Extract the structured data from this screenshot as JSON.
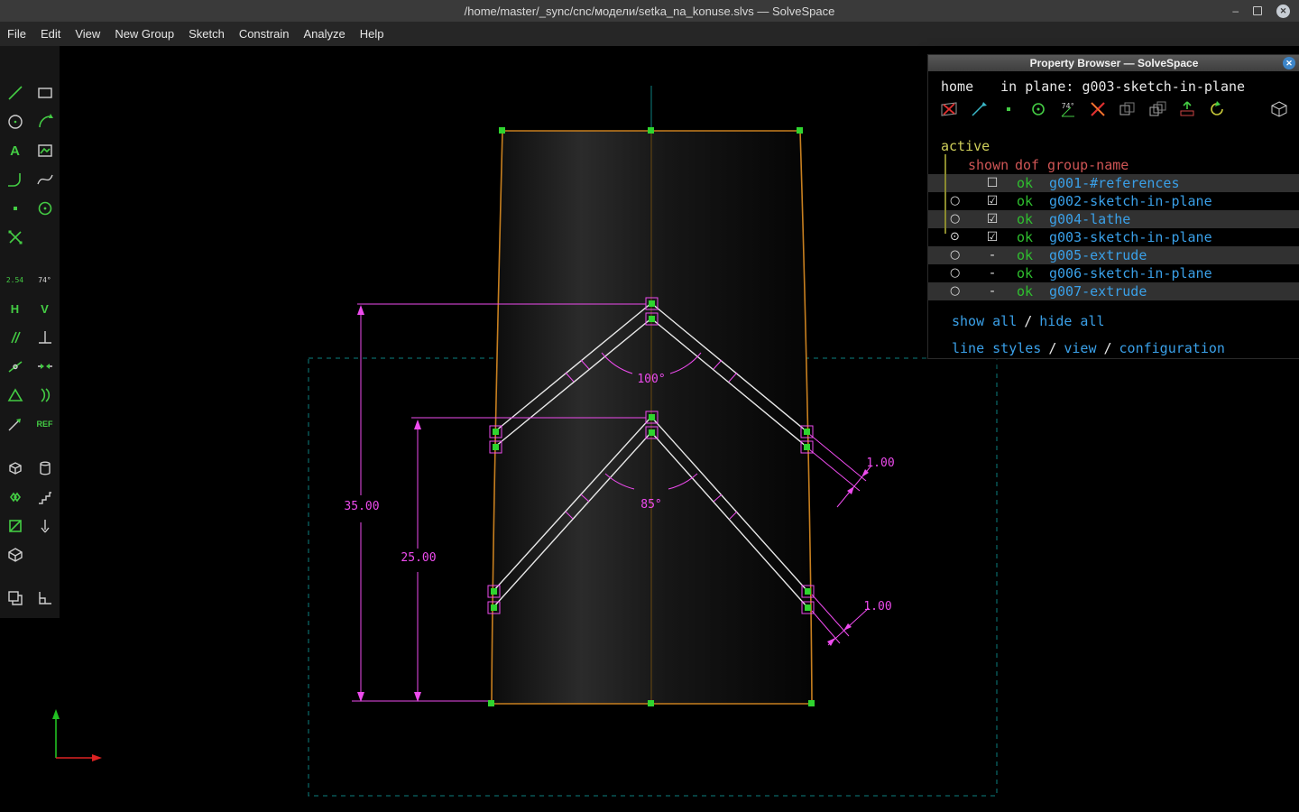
{
  "window": {
    "title": "/home/master/_sync/cnc/модели/setka_na_konuse.slvs — SolveSpace",
    "minimize": "–",
    "restore": "❐",
    "close": "✕"
  },
  "menu": {
    "file": "File",
    "edit": "Edit",
    "view": "View",
    "new_group": "New Group",
    "sketch": "Sketch",
    "constrain": "Constrain",
    "analyze": "Analyze",
    "help": "Help"
  },
  "tools": {
    "text": "A",
    "distance": "2.54",
    "angle": "74°",
    "horizontal": "H",
    "vertical": "V",
    "reference": "REF"
  },
  "canvas": {
    "dim_total": "35.00",
    "dim_lower": "25.00",
    "angle_upper": "100°",
    "angle_lower": "85°",
    "width_upper": "1.00",
    "width_lower": "1.00"
  },
  "pb": {
    "title": "Property Browser — SolveSpace",
    "close": "✕",
    "home": "home",
    "in_plane_label": "in plane:",
    "in_plane_value": "g003-sketch-in-plane",
    "angle_tool_label": "74°",
    "active": "active",
    "header": {
      "shown": "shown",
      "dof": "dof",
      "group_name": "group-name"
    },
    "groups": [
      {
        "radio": "",
        "shown": "☐",
        "dof": "ok",
        "name": "g001-#references"
      },
      {
        "radio": "○",
        "shown": "☑",
        "dof": "ok",
        "name": "g002-sketch-in-plane"
      },
      {
        "radio": "○",
        "shown": "☑",
        "dof": "ok",
        "name": "g004-lathe"
      },
      {
        "radio": "⊙",
        "shown": "☑",
        "dof": "ok",
        "name": "g003-sketch-in-plane"
      },
      {
        "radio": "○",
        "shown": "-",
        "dof": "ok",
        "name": "g005-extrude"
      },
      {
        "radio": "○",
        "shown": "-",
        "dof": "ok",
        "name": "g006-sketch-in-plane"
      },
      {
        "radio": "○",
        "shown": "-",
        "dof": "ok",
        "name": "g007-extrude"
      }
    ],
    "links": {
      "sep": "/",
      "show_all": "show all",
      "hide_all": "hide all",
      "line_styles": "line styles",
      "view": "view",
      "configuration": "configuration"
    }
  }
}
